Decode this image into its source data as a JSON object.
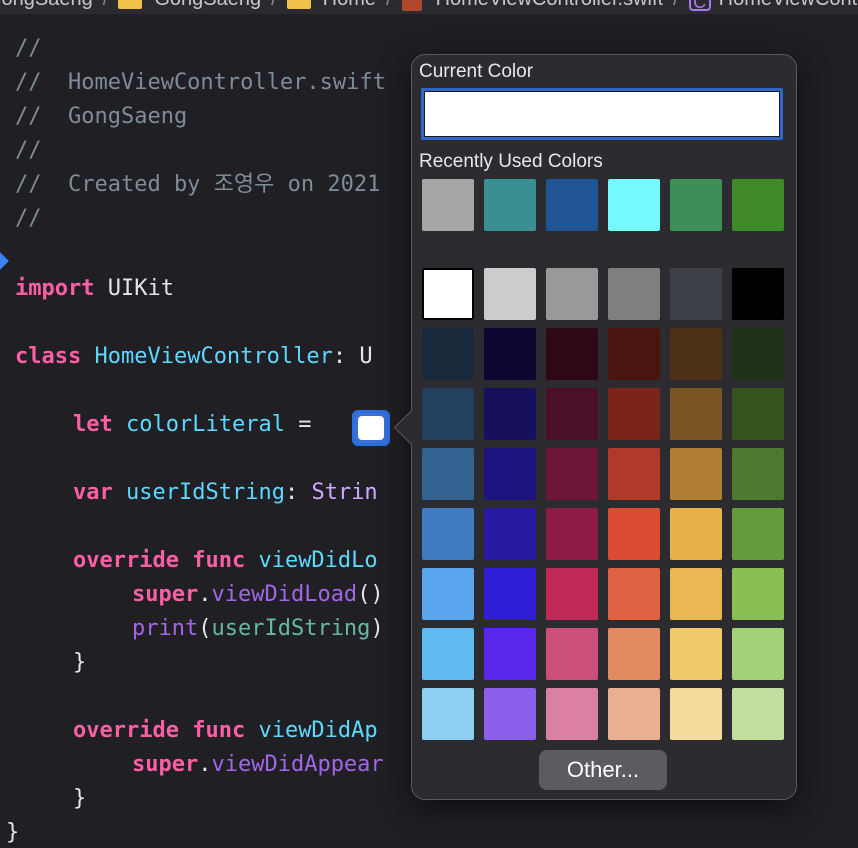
{
  "breadcrumb": {
    "items": [
      {
        "label": "GongSaeng",
        "icon": "folder-icon"
      },
      {
        "label": "GongSaeng",
        "icon": "folder-icon"
      },
      {
        "label": "Home",
        "icon": "folder-icon"
      },
      {
        "label": "HomeViewController.swift",
        "icon": "swift-file-icon"
      },
      {
        "label": "HomeViewController",
        "icon": "class-icon"
      }
    ],
    "separator": "/"
  },
  "code": {
    "comment1": "//",
    "comment2": "//  HomeViewController.swift",
    "comment3": "//  GongSaeng",
    "comment4": "//",
    "comment5": "//  Created by 조영우 on 2021",
    "comment6": "//",
    "import_kw": "import",
    "import_mod": "UIKit",
    "class_kw": "class",
    "class_name": "HomeViewController",
    "class_rest": ": U",
    "let_kw": "let",
    "let_name": "colorLiteral",
    "let_eq": " = ",
    "var_kw": "var",
    "var_name": "userIdString",
    "var_colon": ": ",
    "var_type": "Strin",
    "override1_kw": "override",
    "func1_kw": "func",
    "func1_name": "viewDidLo",
    "super1_kw": "super",
    "super1_call": "viewDidLoad",
    "super1_rest": "()",
    "print_fn": "print",
    "print_open": "(",
    "print_arg": "userIdString",
    "print_close": ")",
    "brace_close1": "}",
    "override2_kw": "override",
    "func2_kw": "func",
    "func2_name": "viewDidAp",
    "super2_kw": "super",
    "super2_call": "viewDidAppear",
    "brace_close2": "}",
    "brace_close3": "}"
  },
  "color_picker": {
    "current_color_label": "Current Color",
    "current_color_value": "#FFFFFF",
    "recent_label": "Recently Used Colors",
    "recent_colors": [
      "#A6A6A6",
      "#3A8F92",
      "#1F5594",
      "#73FBFD",
      "#3D8F58",
      "#3D8A27"
    ],
    "palette_rows": [
      [
        "#FFFFFF",
        "#CCCCCC",
        "#999999",
        "#7F7F7F",
        "#3E4048",
        "#000000"
      ],
      [
        "#182A3C",
        "#0F0731",
        "#2F0716",
        "#4A150F",
        "#4A3016",
        "#1E3016"
      ],
      [
        "#23405E",
        "#17105C",
        "#4B0F27",
        "#7C231A",
        "#7B5424",
        "#35551F"
      ],
      [
        "#32628F",
        "#1E1480",
        "#6D1539",
        "#B0392A",
        "#B17E34",
        "#4D7A2F"
      ],
      [
        "#3E7CBF",
        "#291AA3",
        "#8D1B46",
        "#DC4B32",
        "#E8B24A",
        "#639C3A"
      ],
      [
        "#5AA5EE",
        "#2F1ED5",
        "#BF2A57",
        "#E06242",
        "#EAB852",
        "#88C055"
      ],
      [
        "#61BBF0",
        "#5A28EC",
        "#CC4E7A",
        "#E38A63",
        "#EFCA6C",
        "#A3D178"
      ],
      [
        "#8DCEF3",
        "#8B5EEB",
        "#DB80A5",
        "#EAAE91",
        "#F4DB9B",
        "#C1DFA0"
      ]
    ],
    "other_button_label": "Other..."
  },
  "literal_swatch_color": "#FFFFFF"
}
